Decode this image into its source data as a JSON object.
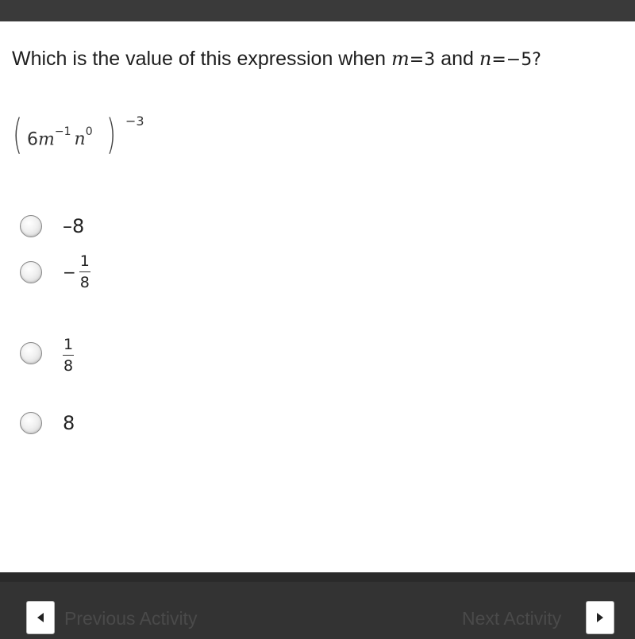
{
  "question": {
    "prefix": "Which is the value of this expression when",
    "m_var": "m",
    "m_eq": "=",
    "m_val": "3",
    "and": "and",
    "n_var": "n",
    "n_eq": "=",
    "n_val": "−5?"
  },
  "expression": {
    "coef": "6",
    "m": "m",
    "m_exp": "−1",
    "n": "n",
    "n_exp": "0",
    "outer_exp": "−3"
  },
  "options": [
    {
      "text": "–8"
    },
    {
      "sign": "−",
      "numerator": "1",
      "denominator": "8"
    },
    {
      "numerator": "1",
      "denominator": "8"
    },
    {
      "text": "8"
    }
  ],
  "footer": {
    "previous_label": "Previous Activity",
    "next_label": "Next Activity"
  },
  "icons": {
    "previous": "triangle-left-icon",
    "next": "triangle-right-icon"
  }
}
